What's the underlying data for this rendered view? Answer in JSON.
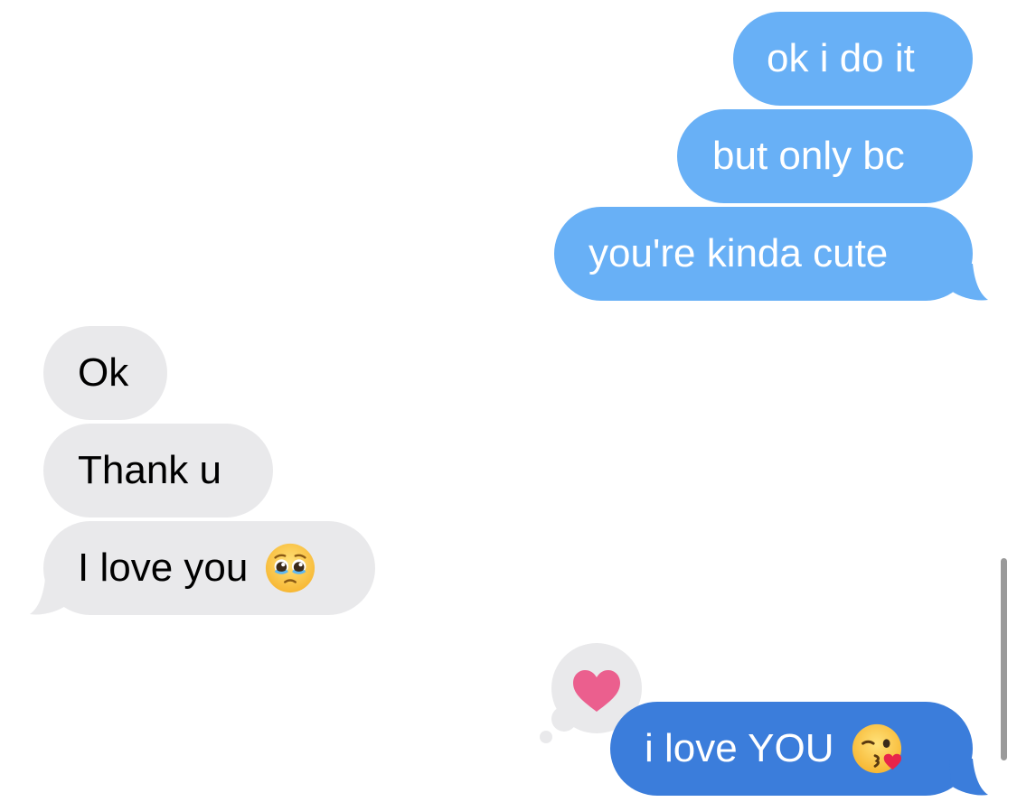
{
  "conversation": {
    "messages": [
      {
        "direction": "outgoing",
        "text": "ok i do it"
      },
      {
        "direction": "outgoing",
        "text": "but only bc"
      },
      {
        "direction": "outgoing",
        "text": "you're kinda cute"
      },
      {
        "direction": "incoming",
        "text": "Ok"
      },
      {
        "direction": "incoming",
        "text": "Thank u"
      },
      {
        "direction": "incoming",
        "text": "I love you",
        "emoji": "pleading-face-emoji"
      },
      {
        "direction": "outgoing",
        "text": "i love YOU",
        "emoji": "face-blowing-kiss-emoji",
        "reaction": "heart-reaction-icon"
      }
    ]
  },
  "colors": {
    "outgoing_bubble": "#68b0f6",
    "outgoing_bubble_last": "#3b7ddb",
    "incoming_bubble": "#e9e9eb",
    "heart": "#eb5f8e"
  }
}
